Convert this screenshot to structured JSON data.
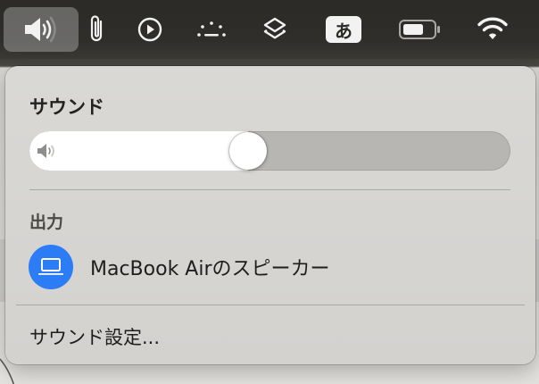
{
  "menubar": {
    "items": [
      {
        "icon": "speaker-volume-icon",
        "active": true
      },
      {
        "icon": "paperclip-icon",
        "active": false
      },
      {
        "icon": "play-circle-icon",
        "active": false
      },
      {
        "icon": "dots-arc-icon",
        "active": false
      },
      {
        "icon": "layers-icon",
        "active": false
      },
      {
        "icon": "input-method-icon",
        "label": "あ",
        "active": false
      },
      {
        "icon": "battery-icon",
        "active": false
      },
      {
        "icon": "wifi-icon",
        "active": false
      }
    ]
  },
  "sound_menu": {
    "title": "サウンド",
    "volume": {
      "level": 0.45,
      "icon": "speaker-low-icon"
    },
    "output_section": {
      "label": "出力",
      "devices": [
        {
          "name": "MacBook Airのスピーカー",
          "icon": "laptop-icon",
          "selected": true
        }
      ]
    },
    "settings_label": "サウンド設定..."
  },
  "colors": {
    "menubar": "#2b2a27",
    "panel": "#d9d8d5",
    "accent": "#2c7cf6"
  }
}
